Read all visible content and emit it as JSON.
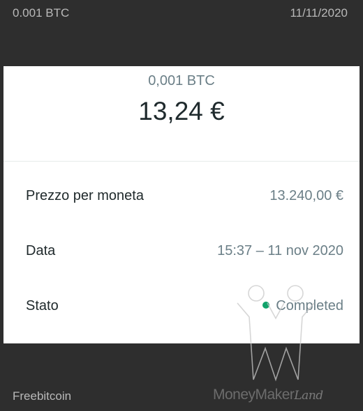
{
  "topbar": {
    "amount": "0.001 BTC",
    "date": "11/11/2020"
  },
  "card": {
    "crypto_amount": "0,001 BTC",
    "fiat_amount": "13,24 €",
    "rows": [
      {
        "label": "Prezzo per moneta",
        "value": "13.240,00 €"
      },
      {
        "label": "Data",
        "value": "15:37 – 11 nov 2020"
      },
      {
        "label": "Stato",
        "value": "Completed",
        "status_color": "#10a36b"
      }
    ]
  },
  "footer": {
    "source": "Freebitcoin",
    "brand": {
      "main": "MoneyMaker",
      "script": "Land"
    }
  },
  "colors": {
    "background": "#2e2e2e",
    "card": "#ffffff",
    "accent_green": "#10a36b"
  }
}
